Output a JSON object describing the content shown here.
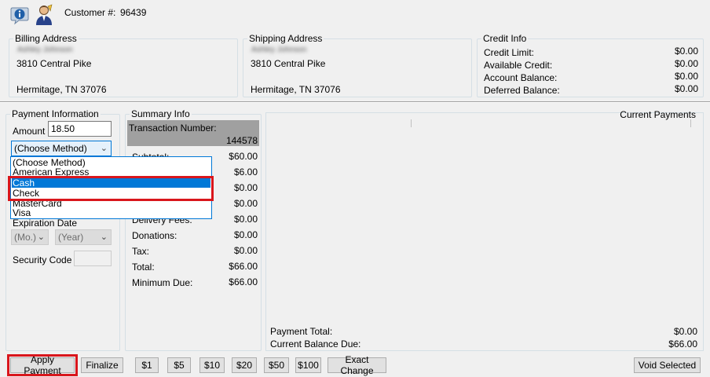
{
  "header": {
    "customer_label": "Customer #:",
    "customer_number": "96439"
  },
  "billing": {
    "title": "Billing Address",
    "name": "Ashley Johnson",
    "street": "3810 Central Pike",
    "city": "Hermitage, TN 37076"
  },
  "shipping": {
    "title": "Shipping Address",
    "name": "Ashley Johnson",
    "street": "3810 Central Pike",
    "city": "Hermitage, TN 37076"
  },
  "credit": {
    "title": "Credit Info",
    "rows": [
      {
        "label": "Credit Limit:",
        "value": "$0.00"
      },
      {
        "label": "Available Credit:",
        "value": "$0.00"
      },
      {
        "label": "Account Balance:",
        "value": "$0.00"
      },
      {
        "label": "Deferred Balance:",
        "value": "$0.00"
      }
    ]
  },
  "payment": {
    "title": "Payment Information",
    "amount_label": "Amount",
    "amount_value": "18.50",
    "method_selected": "(Choose Method)",
    "method_options": [
      "(Choose Method)",
      "American Express",
      "Cash",
      "Check",
      "MasterCard",
      "Visa"
    ],
    "highlighted_option": "Cash",
    "expiration_label": "Expiration Date",
    "month_placeholder": "(Mo.)",
    "year_placeholder": "(Year)",
    "security_label": "Security Code"
  },
  "summary": {
    "title": "Summary Info",
    "transaction_label": "Transaction Number:",
    "transaction_number": "144578",
    "rows": [
      {
        "label": "Subtotal:",
        "value": "$60.00"
      },
      {
        "label": "",
        "value": "$6.00"
      },
      {
        "label": "",
        "value": "$0.00"
      },
      {
        "label": "",
        "value": "$0.00"
      },
      {
        "label": "Delivery Fees:",
        "value": "$0.00"
      },
      {
        "label": "Donations:",
        "value": "$0.00"
      },
      {
        "label": "Tax:",
        "value": "$0.00"
      },
      {
        "label": "Total:",
        "value": "$66.00"
      },
      {
        "label": "Minimum Due:",
        "value": "$66.00"
      }
    ]
  },
  "current_payments": {
    "title": "Current Payments",
    "payment_total_label": "Payment Total:",
    "payment_total_value": "$0.00",
    "balance_due_label": "Current Balance Due:",
    "balance_due_value": "$66.00"
  },
  "buttons": {
    "apply": "Apply Payment",
    "finalize": "Finalize",
    "d1": "$1",
    "d5": "$5",
    "d10": "$10",
    "d20": "$20",
    "d50": "$50",
    "d100": "$100",
    "exact": "Exact Change",
    "void": "Void Selected"
  },
  "colors": {
    "highlight": "#0078d7",
    "annotation": "#d9161c",
    "transaction_bg": "#a0a0a0"
  }
}
